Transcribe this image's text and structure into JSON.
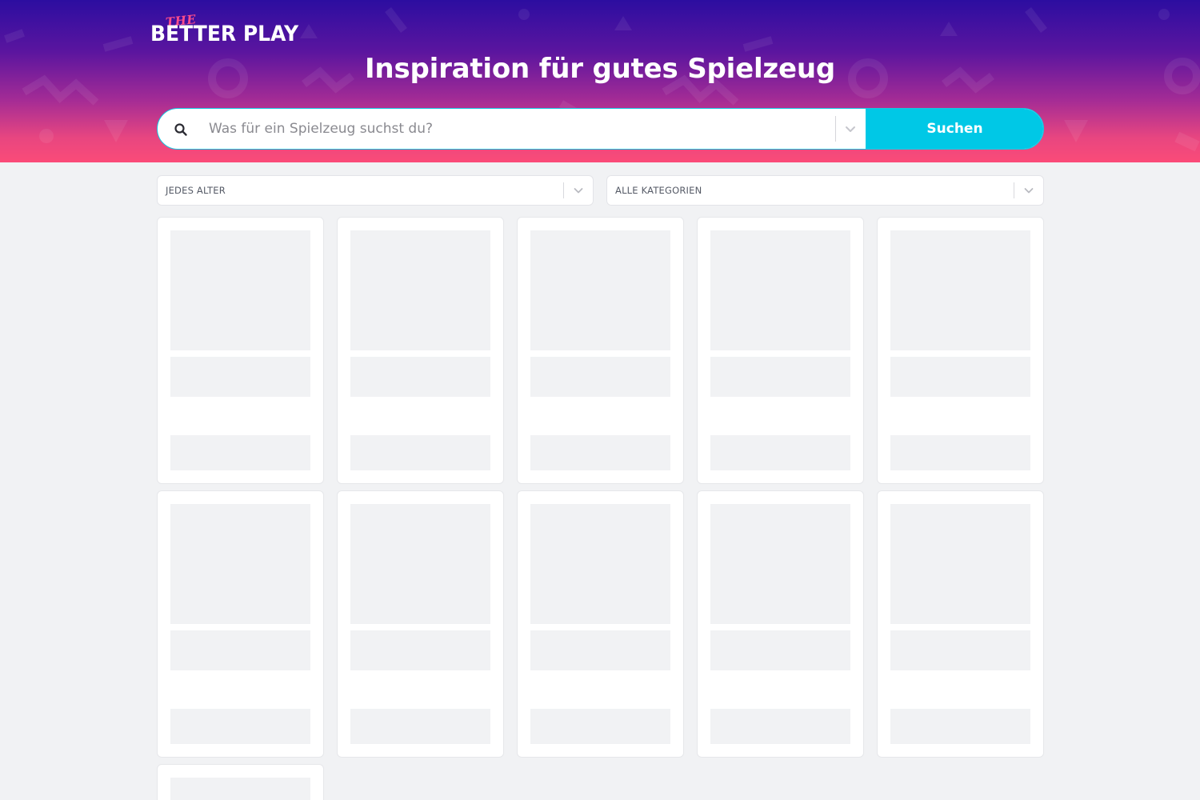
{
  "header": {
    "logo": {
      "small": "THE",
      "main": "BETTER PLAY"
    },
    "title": "Inspiration für gutes Spielzeug"
  },
  "search": {
    "placeholder": "Was für ein Spielzeug suchst du?",
    "button_label": "Suchen",
    "icon": "search-icon",
    "dropdown_icon": "chevron-down-icon"
  },
  "filters": {
    "age": {
      "label": "JEDES ALTER"
    },
    "category": {
      "label": "ALLE KATEGORIEN"
    }
  },
  "colors": {
    "header_gradient_top": "#2c0da0",
    "header_gradient_bottom": "#fb4b78",
    "accent": "#00c8e6",
    "logo_accent": "#ff4d8b",
    "page_background": "#f1f2f4",
    "skeleton": "#f1f2f4"
  },
  "product_grid": {
    "state": "loading",
    "placeholder_cards": 11
  }
}
